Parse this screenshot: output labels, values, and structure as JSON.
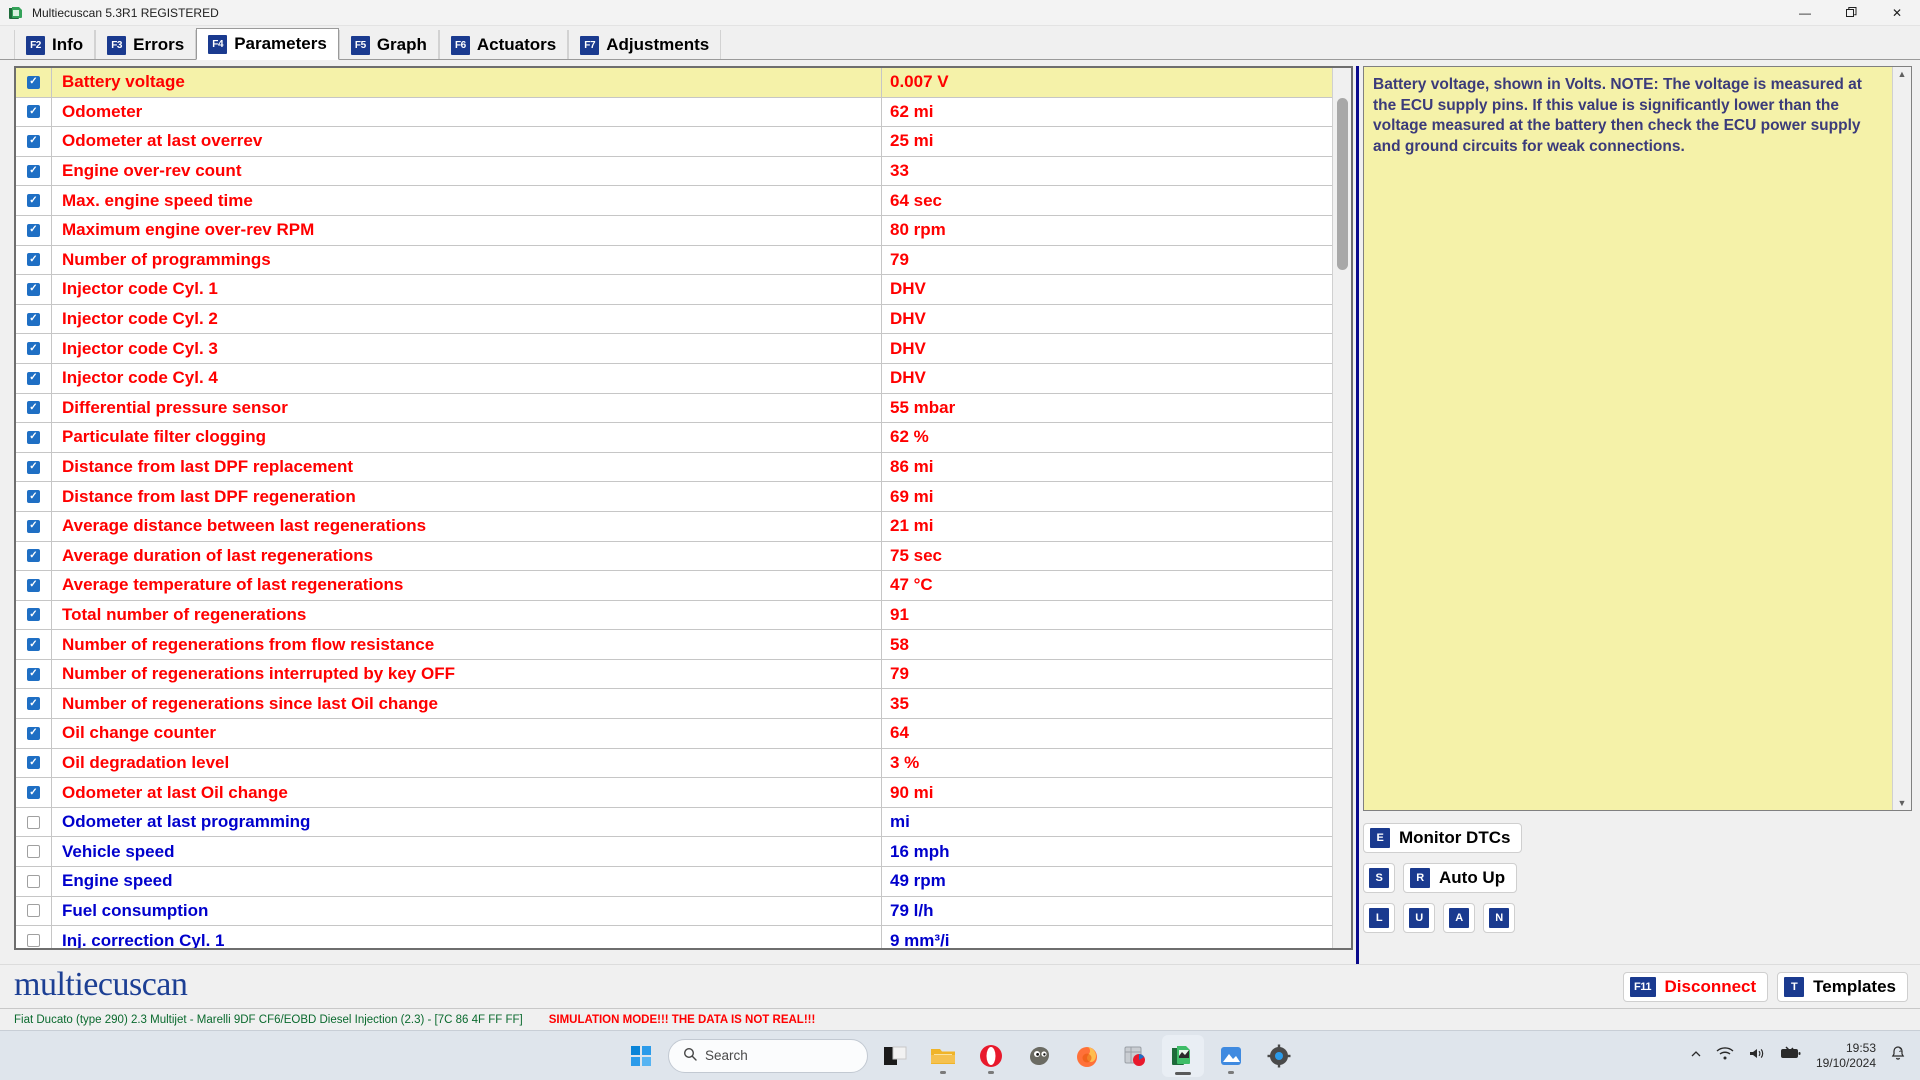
{
  "window": {
    "title": "Multiecuscan 5.3R1 REGISTERED",
    "minimize": "—",
    "maximize": "❐",
    "close": "✕"
  },
  "tabs": [
    {
      "key": "F2",
      "label": "Info",
      "active": false
    },
    {
      "key": "F3",
      "label": "Errors",
      "active": false
    },
    {
      "key": "F4",
      "label": "Parameters",
      "active": true
    },
    {
      "key": "F5",
      "label": "Graph",
      "active": false
    },
    {
      "key": "F6",
      "label": "Actuators",
      "active": false
    },
    {
      "key": "F7",
      "label": "Adjustments",
      "active": false
    }
  ],
  "parameters": [
    {
      "checked": true,
      "name": "Battery voltage",
      "value": "0.007 V",
      "selected": true
    },
    {
      "checked": true,
      "name": "Odometer",
      "value": "62 mi",
      "selected": false
    },
    {
      "checked": true,
      "name": "Odometer at last overrev",
      "value": "25 mi",
      "selected": false
    },
    {
      "checked": true,
      "name": "Engine over-rev count",
      "value": "33",
      "selected": false
    },
    {
      "checked": true,
      "name": "Max. engine speed time",
      "value": "64 sec",
      "selected": false
    },
    {
      "checked": true,
      "name": "Maximum engine over-rev RPM",
      "value": "80 rpm",
      "selected": false
    },
    {
      "checked": true,
      "name": "Number of programmings",
      "value": "79",
      "selected": false
    },
    {
      "checked": true,
      "name": "Injector code Cyl. 1",
      "value": "DHV",
      "selected": false
    },
    {
      "checked": true,
      "name": "Injector code Cyl. 2",
      "value": "DHV",
      "selected": false
    },
    {
      "checked": true,
      "name": "Injector code Cyl. 3",
      "value": "DHV",
      "selected": false
    },
    {
      "checked": true,
      "name": "Injector code Cyl. 4",
      "value": "DHV",
      "selected": false
    },
    {
      "checked": true,
      "name": "Differential pressure sensor",
      "value": "55 mbar",
      "selected": false
    },
    {
      "checked": true,
      "name": "Particulate filter clogging",
      "value": "62 %",
      "selected": false
    },
    {
      "checked": true,
      "name": "Distance from last DPF replacement",
      "value": "86 mi",
      "selected": false
    },
    {
      "checked": true,
      "name": "Distance from last DPF regeneration",
      "value": "69 mi",
      "selected": false
    },
    {
      "checked": true,
      "name": "Average distance between last regenerations",
      "value": "21 mi",
      "selected": false
    },
    {
      "checked": true,
      "name": "Average duration of last regenerations",
      "value": "75 sec",
      "selected": false
    },
    {
      "checked": true,
      "name": "Average temperature of last regenerations",
      "value": "47 °C",
      "selected": false
    },
    {
      "checked": true,
      "name": "Total number of regenerations",
      "value": "91",
      "selected": false
    },
    {
      "checked": true,
      "name": "Number of regenerations from flow resistance",
      "value": "58",
      "selected": false
    },
    {
      "checked": true,
      "name": "Number of regenerations interrupted by key OFF",
      "value": "79",
      "selected": false
    },
    {
      "checked": true,
      "name": "Number of regenerations since last Oil change",
      "value": "35",
      "selected": false
    },
    {
      "checked": true,
      "name": "Oil change counter",
      "value": "64",
      "selected": false
    },
    {
      "checked": true,
      "name": "Oil degradation level",
      "value": "3 %",
      "selected": false
    },
    {
      "checked": true,
      "name": "Odometer at last Oil change",
      "value": "90 mi",
      "selected": false
    },
    {
      "checked": false,
      "name": "Odometer at last programming",
      "value": " mi",
      "selected": false
    },
    {
      "checked": false,
      "name": "Vehicle speed",
      "value": "16 mph",
      "selected": false
    },
    {
      "checked": false,
      "name": "Engine speed",
      "value": "49 rpm",
      "selected": false
    },
    {
      "checked": false,
      "name": "Fuel consumption",
      "value": "79 l/h",
      "selected": false
    },
    {
      "checked": false,
      "name": "Inj. correction Cyl. 1",
      "value": "9 mm³/i",
      "selected": false
    }
  ],
  "info_panel": {
    "text": "Battery voltage, shown in Volts.\nNOTE: The voltage is measured at the ECU supply pins. If this value is significantly lower than the voltage measured at the battery then check the ECU power supply and ground circuits for weak connections."
  },
  "actions": {
    "monitor_dtcs": {
      "key": "E",
      "label": "Monitor DTCs"
    },
    "stop": {
      "key": "S",
      "label": ""
    },
    "auto_up": {
      "key": "R",
      "label": "Auto Up"
    },
    "small_keys": [
      "L",
      "U",
      "A",
      "N"
    ]
  },
  "bottom": {
    "logo": "multiecuscan",
    "disconnect": {
      "key": "F11",
      "label": "Disconnect"
    },
    "templates": {
      "key": "T",
      "label": "Templates"
    }
  },
  "statusbar": {
    "vehicle": "Fiat Ducato (type 290) 2.3 Multijet - Marelli 9DF CF6/EOBD Diesel Injection (2.3) - [7C 86 4F FF FF]",
    "simulation": "SIMULATION MODE!!! THE DATA IS NOT REAL!!!"
  },
  "taskbar": {
    "search_placeholder": "Search",
    "icons": [
      "start-icon",
      "file-explorer-dark-icon",
      "folder-icon",
      "opera-icon",
      "gimp-icon",
      "firefox-icon",
      "database-icon",
      "multiecuscan-icon",
      "photos-icon",
      "settings-icon"
    ],
    "tray": {
      "time": "19:53",
      "date": "19/10/2024"
    }
  },
  "colors": {
    "param_active": "#ff0000",
    "param_inactive": "#0000cc",
    "selected_row": "#f5f2a9",
    "accent_blue": "#1a3a8f",
    "logo_blue": "#1c3f94",
    "status_green": "#0a6a2e"
  }
}
